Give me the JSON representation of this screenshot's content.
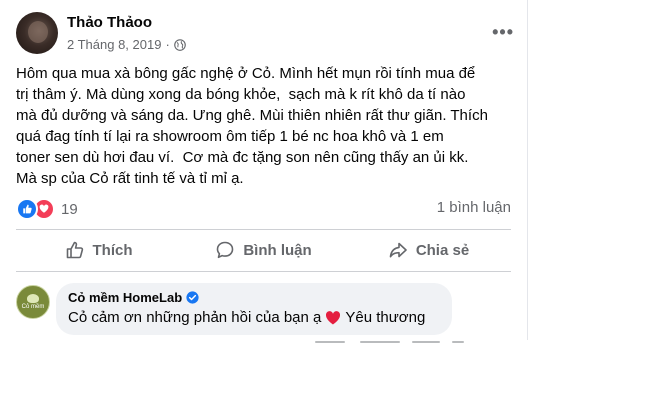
{
  "post": {
    "author": "Thảo Thảoo",
    "date": "2 Tháng 8, 2019",
    "privacy_icon": "globe-icon",
    "more_label": "•••",
    "text": "Hôm qua mua xà bông gấc nghệ ở Cỏ. Mình hết mụn rồi tính mua để\ntrị thâm ý. Mà dùng xong da bóng khỏe,  sạch mà k rít khô da tí nào\nmà đủ dưỡng và sáng da. Ưng ghê. Mùi thiên nhiên rất thư giãn. Thích\nquá đag tính tí lại ra showroom ôm tiếp 1 bé nc hoa khô và 1 em\ntoner sen dù hơi đau ví.  Cơ mà đc tặng son nên cũng thấy an ủi kk.\nMà sp của Cỏ rất tinh tế và tỉ mỉ ạ."
  },
  "stats": {
    "reaction_count": "19",
    "comment_count": "1 bình luận"
  },
  "actions": {
    "like": "Thích",
    "comment": "Bình luận",
    "share": "Chia sẻ"
  },
  "comment": {
    "author": "Cỏ mềm HomeLab",
    "avatar_text": "Cỏ mềm",
    "text": "Cỏ cảm ơn những phản hồi của bạn ạ",
    "text_after": "Yêu thương"
  },
  "colors": {
    "like_blue": "#1877f2",
    "love_red": "#f33e58",
    "secondary_text": "#65676b"
  }
}
